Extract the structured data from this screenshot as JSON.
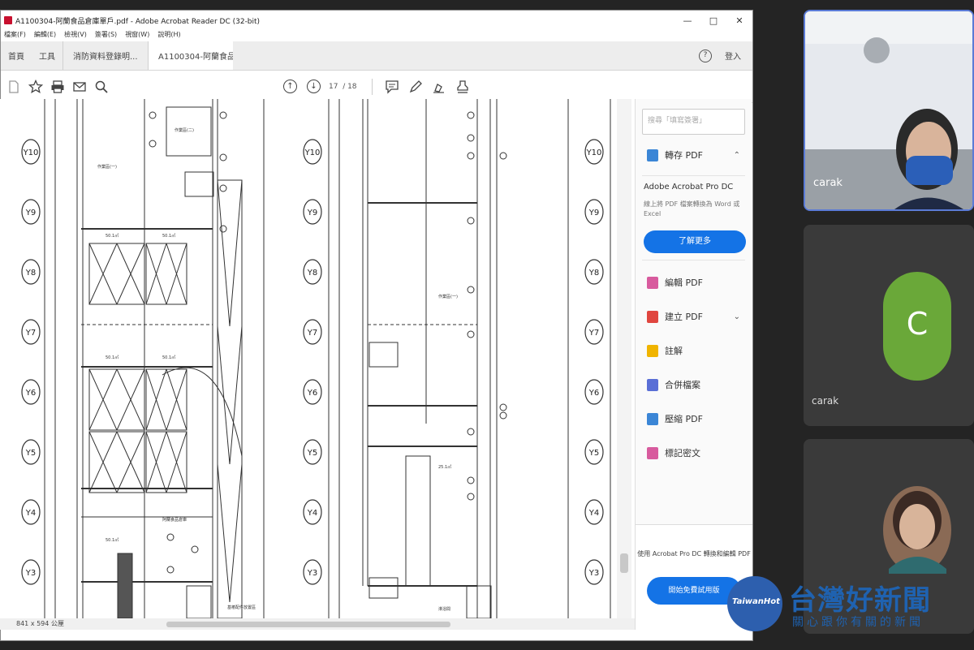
{
  "window": {
    "title": "A1100304-阿蘭食品倉庫單戶.pdf - Adobe Acrobat Reader DC (32-bit)",
    "menus": [
      "檔案(F)",
      "編輯(E)",
      "檢視(V)",
      "簽署(S)",
      "視窗(W)",
      "說明(H)"
    ],
    "controls": [
      "—",
      "□",
      "✕"
    ]
  },
  "tabs": {
    "home": "首頁",
    "tools": "工具",
    "doc1": "消防資料登錄明...",
    "doc2": "A1100304-阿蘭食品...",
    "help": "?",
    "login": "登入"
  },
  "toolbar": {
    "page_current": "17",
    "page_total": "/ 18"
  },
  "drawing": {
    "row_labels": [
      "Y10",
      "Y9",
      "Y8",
      "Y7",
      "Y6",
      "Y5",
      "Y4",
      "Y3"
    ]
  },
  "status": {
    "page_size": "841 x 594 公厘"
  },
  "tools_pane": {
    "search_placeholder": "搜尋「填寫簽署」",
    "export_pdf": "轉存 PDF",
    "promo_title": "Adobe Acrobat Pro DC",
    "promo_desc": "線上將 PDF 檔案轉換為 Word 或 Excel",
    "learn_more": "了解更多",
    "items": [
      "編輯 PDF",
      "建立 PDF",
      "註解",
      "合併檔案",
      "壓縮 PDF",
      "標記密文"
    ],
    "bottom_text": "使用 Acrobat Pro DC 轉換和編輯 PDF",
    "trial_button": "開始免費試用版"
  },
  "participants": {
    "p1_name": "carak",
    "p2_initial": "C",
    "p2_name": "carak"
  },
  "watermark": {
    "logo_text": "TaiwanHot",
    "title": "台灣好新聞",
    "subtitle": "關心跟你有關的新聞"
  },
  "colors": {
    "acrobat_blue": "#1473e6",
    "avatar_green": "#6aa839",
    "speaker_border": "#5b7bd6",
    "watermark_blue": "#1f62b0"
  }
}
